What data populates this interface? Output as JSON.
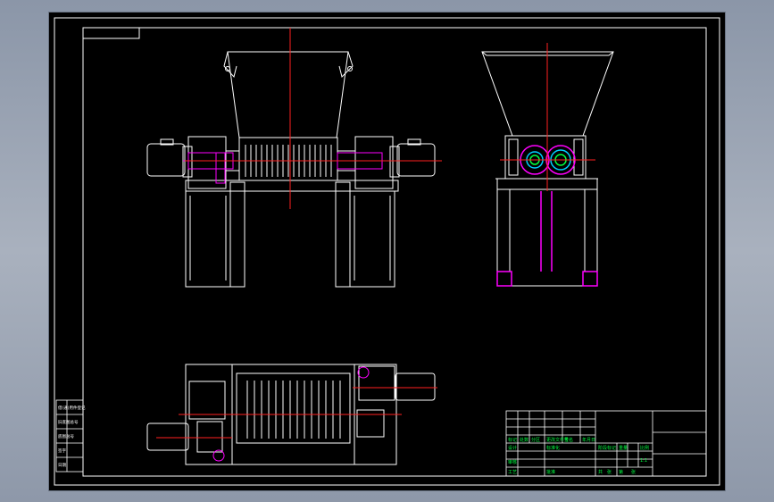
{
  "drawing": {
    "colors": {
      "background": "#000000",
      "line": "#ffffff",
      "center_line": "#ff2020",
      "hidden_parts": "#ff00ff",
      "title_text": "#00ff40"
    },
    "title_block": {
      "cells": [
        "标记",
        "处数",
        "分区",
        "更改文件号",
        "签名",
        "年月日",
        "设计",
        "标准化",
        "阶段标记",
        "重量",
        "比例",
        "审核",
        "工艺",
        "批准",
        "共",
        "张",
        "第",
        "张",
        "1:1"
      ]
    },
    "left_side_table": {
      "cells": [
        "借(通)用件登记",
        "旧底图总号",
        "底图总号",
        "签字",
        "日期"
      ]
    }
  }
}
